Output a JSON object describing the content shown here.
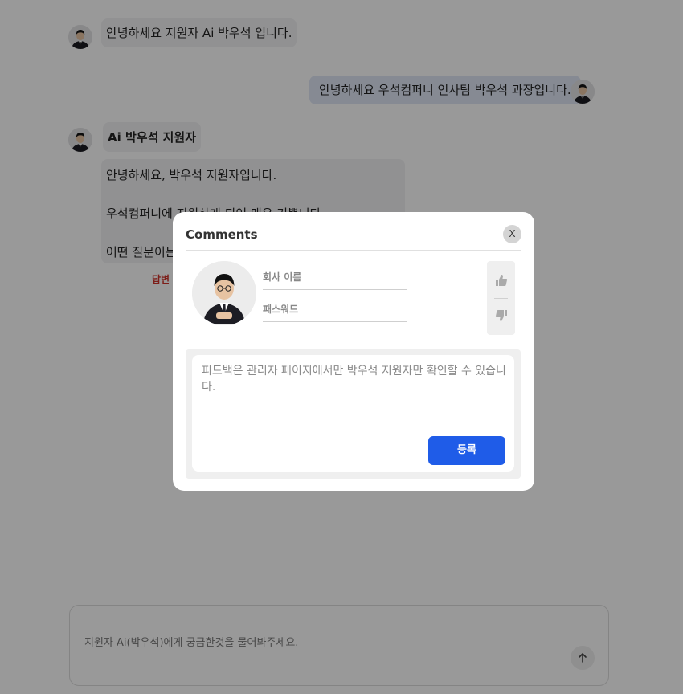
{
  "messages": [
    {
      "role": "bot",
      "text": "안녕하세요 지원자 Ai 박우석 입니다."
    },
    {
      "role": "user",
      "text": "안녕하세요 우석컴퍼니 인사팀 박우석 과장입니다."
    }
  ],
  "answer": {
    "name": "Ai 박우석 지원자",
    "lines": [
      "안녕하세요, 박우석 지원자입니다.",
      "우석컴퍼니에 지원하게 되어 매우 기쁩니다.",
      "어떤 질문이든"
    ],
    "link_label": "답변"
  },
  "chat_input": {
    "placeholder": "지원자 Ai(박우석)에게 궁금한것을 물어봐주세요.",
    "send_icon": "arrow-up-icon"
  },
  "modal": {
    "title": "Comments",
    "close_label": "X",
    "company_placeholder": "회사 이름",
    "password_placeholder": "패스워드",
    "vote_icons": [
      "thumbs-up-icon",
      "thumbs-down-icon"
    ],
    "feedback_placeholder": "피드백은 관리자 페이지에서만 박우석 지원자만 확인할 수 있습니다.",
    "submit_label": "등록"
  },
  "colors": {
    "accent": "#1f5ce8",
    "bot_bubble": "#f2f2f3",
    "user_bubble": "#dfe7f6",
    "link_red": "#d0322b"
  }
}
